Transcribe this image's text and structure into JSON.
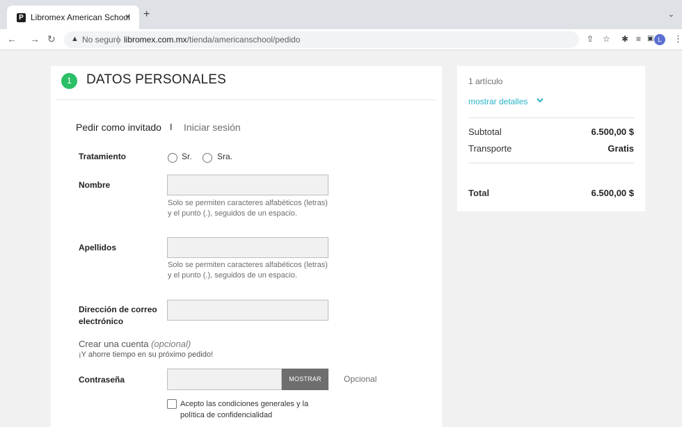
{
  "browser": {
    "tab_title": "Libromex American School",
    "tab_favicon": "P",
    "tab_close": "×",
    "new_tab": "+",
    "security_label": "No seguro",
    "url_domain": "libromex.com.mx",
    "url_path": "/tienda/americanschool/pedido",
    "profile_initial": "L",
    "icons": [
      "back-icon",
      "forward-icon",
      "reload-icon",
      "warning-icon",
      "share-icon",
      "star-icon",
      "extensions-icon",
      "reading-list-icon",
      "side-panel-icon",
      "profile-avatar",
      "menu-icon"
    ]
  },
  "step": {
    "number": "1",
    "title": "DATOS PERSONALES",
    "accent_color": "#2bbf67"
  },
  "auth": {
    "guest": "Pedir como invitado",
    "separator": "I",
    "login": "Iniciar sesión"
  },
  "form": {
    "treatment_label": "Tratamiento",
    "treatment_options": [
      "Sr.",
      "Sra."
    ],
    "name_label": "Nombre",
    "name_value": "",
    "name_help": "Solo se permiten caracteres alfabéticos (letras) y el punto (.), seguidos de un espacio.",
    "surname_label": "Apellidos",
    "surname_value": "",
    "surname_help": "Solo se permiten caracteres alfabéticos (letras) y el punto (.), seguidos de un espacio.",
    "email_label": "Dirección de correo electrónico",
    "email_value": "",
    "create_title": "Crear una cuenta",
    "create_optional": "(opcional)",
    "create_sub": "¡Y ahorre tiempo en su próximo pedido!",
    "password_label": "Contraseña",
    "password_value": "",
    "show_button": "MOSTRAR",
    "password_optional": "Opcional",
    "terms_label": "Acepto las condiciones generales y la política de confidencialidad"
  },
  "summary": {
    "items_count": "1 artículo",
    "details_toggle": "mostrar detalles",
    "link_color": "#26b3c7",
    "subtotal_label": "Subtotal",
    "subtotal_value": "6.500,00 $",
    "shipping_label": "Transporte",
    "shipping_value": "Gratis",
    "total_label": "Total",
    "total_value": "6.500,00 $"
  }
}
